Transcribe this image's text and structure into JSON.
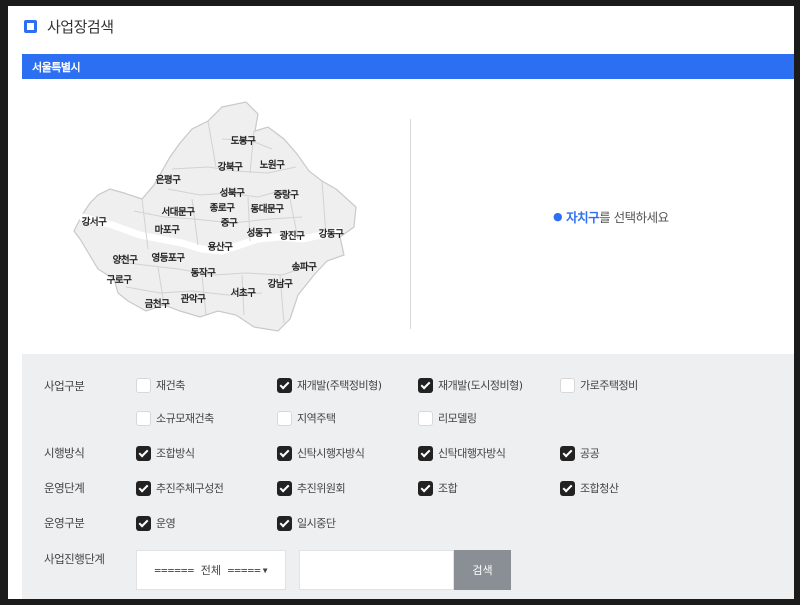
{
  "header": {
    "title": "사업장검색"
  },
  "region": {
    "name": "서울특별시"
  },
  "map": {
    "districts": [
      "도봉구",
      "강북구",
      "노원구",
      "은평구",
      "성북구",
      "중랑구",
      "서대문구",
      "종로구",
      "동대문구",
      "강서구",
      "마포구",
      "중구",
      "성동구",
      "광진구",
      "강동구",
      "용산구",
      "양천구",
      "영등포구",
      "구로구",
      "동작구",
      "송파구",
      "강남구",
      "서초구",
      "금천구",
      "관악구"
    ]
  },
  "prompt": {
    "highlight": "자치구",
    "rest": "를 선택하세요"
  },
  "filters": {
    "business_type": {
      "label": "사업구분",
      "options": [
        {
          "label": "재건축",
          "checked": false
        },
        {
          "label": "재개발(주택정비형)",
          "checked": true
        },
        {
          "label": "재개발(도시정비형)",
          "checked": true
        },
        {
          "label": "가로주택정비",
          "checked": false
        },
        {
          "label": "소규모재건축",
          "checked": false
        },
        {
          "label": "지역주택",
          "checked": false
        },
        {
          "label": "리모델링",
          "checked": false
        }
      ]
    },
    "method": {
      "label": "시행방식",
      "options": [
        {
          "label": "조합방식",
          "checked": true
        },
        {
          "label": "신탁시행자방식",
          "checked": true
        },
        {
          "label": "신탁대행자방식",
          "checked": true
        },
        {
          "label": "공공",
          "checked": true
        }
      ]
    },
    "stage": {
      "label": "운영단계",
      "options": [
        {
          "label": "추진주체구성전",
          "checked": true
        },
        {
          "label": "추진위원회",
          "checked": true
        },
        {
          "label": "조합",
          "checked": true
        },
        {
          "label": "조합청산",
          "checked": true
        }
      ]
    },
    "status": {
      "label": "운영구분",
      "options": [
        {
          "label": "운영",
          "checked": true
        },
        {
          "label": "일시중단",
          "checked": true
        }
      ]
    },
    "progress": {
      "label": "사업진행단계",
      "selected": "====== 전체 =====",
      "search_value": "",
      "search_button": "검색"
    }
  }
}
